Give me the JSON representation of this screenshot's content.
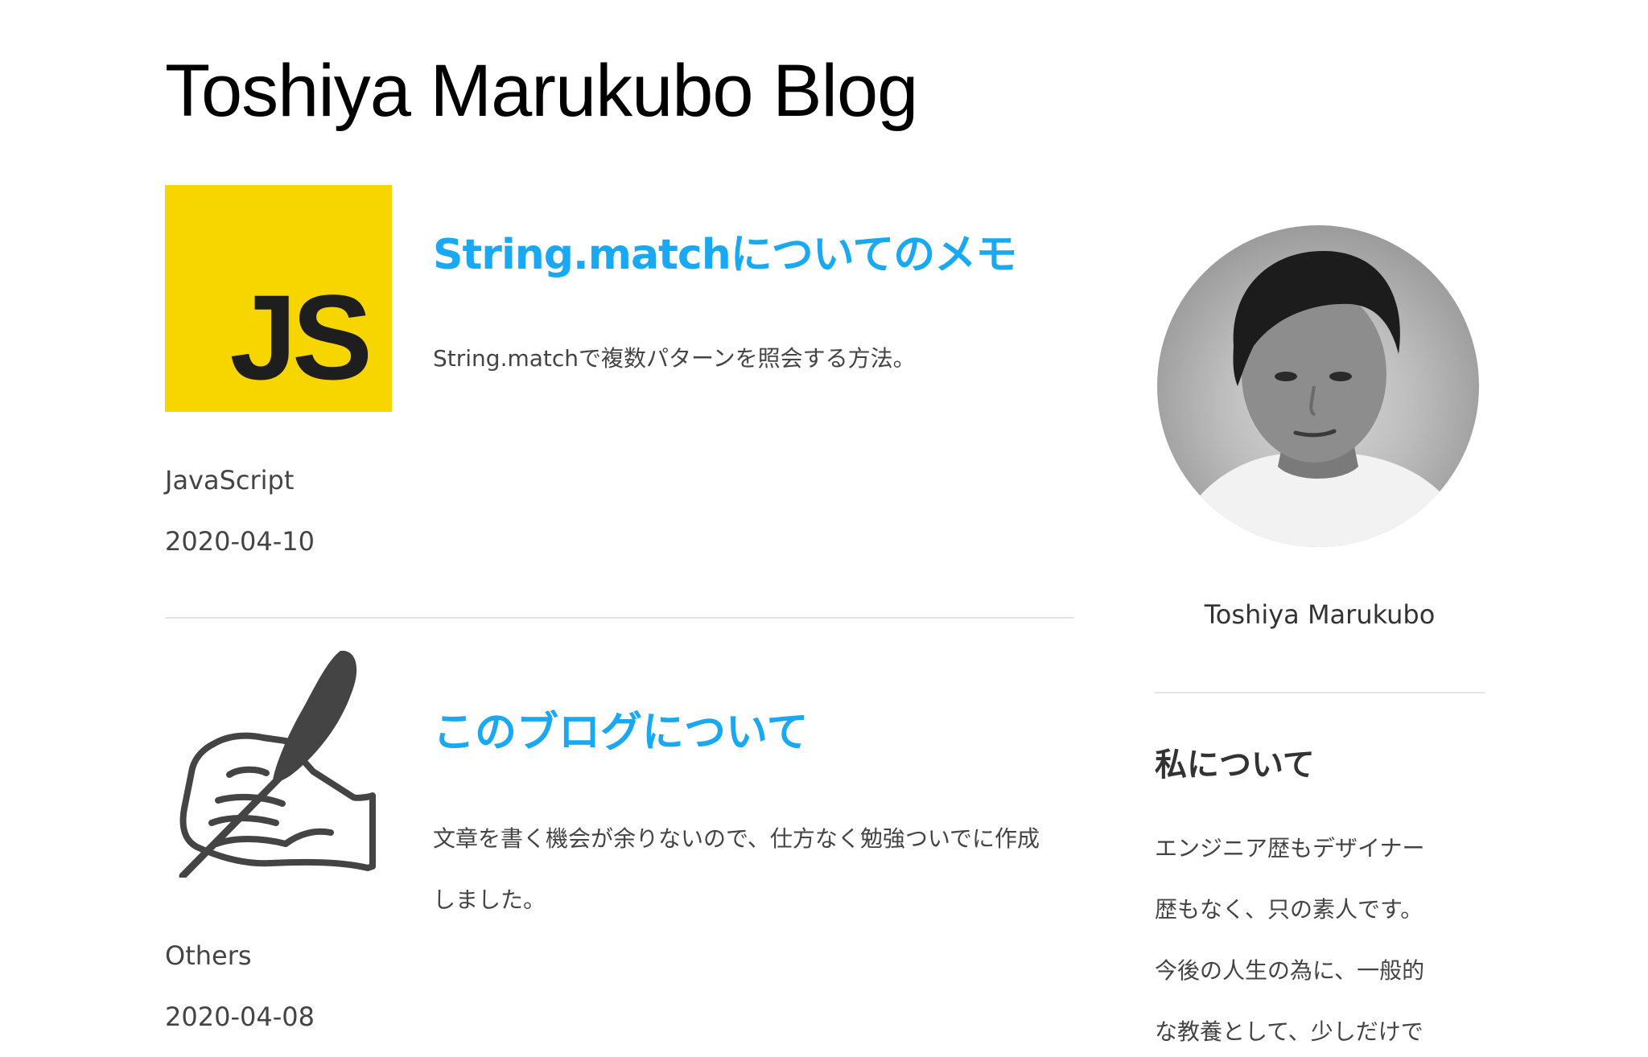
{
  "header": {
    "blog_title": "Toshiya Marukubo Blog"
  },
  "posts": [
    {
      "title": "String.matchについてのメモ",
      "excerpt": "String.matchで複数パターンを照会する方法。",
      "category": "JavaScript",
      "date": "2020-04-10",
      "thumbnail": {
        "icon": "javascript-logo-icon",
        "text": "JS",
        "bg_color": "#f7d600"
      }
    },
    {
      "title": "このブログについて",
      "excerpt": "文章を書く機会が余りないので、仕方なく勉強ついでに作成しました。",
      "category": "Others",
      "date": "2020-04-08",
      "thumbnail": {
        "icon": "hand-writing-quill-icon"
      }
    }
  ],
  "sidebar": {
    "author_name": "Toshiya Marukubo",
    "about_heading": "私について",
    "about_text": "エンジニア歴もデザイナー\n歴もなく、只の素人です。\n今後の人生の為に、一般的\nな教養として、少しだけで"
  },
  "colors": {
    "accent": "#18a9f2",
    "text": "#444444",
    "title": "#000000",
    "divider": "#e6e6e6"
  }
}
